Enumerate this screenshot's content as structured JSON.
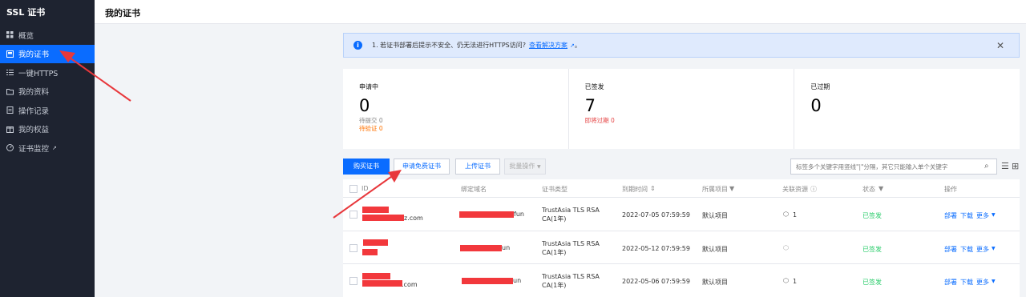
{
  "sidebar": {
    "brand": "SSL 证书",
    "items": [
      {
        "label": "概览",
        "icon": "grid-icon"
      },
      {
        "label": "我的证书",
        "icon": "certificate-icon"
      },
      {
        "label": "一键HTTPS",
        "icon": "list-icon"
      },
      {
        "label": "我的资料",
        "icon": "folder-icon"
      },
      {
        "label": "操作记录",
        "icon": "record-icon"
      },
      {
        "label": "我的权益",
        "icon": "gift-icon"
      },
      {
        "label": "证书监控",
        "icon": "monitor-icon"
      }
    ]
  },
  "header": {
    "title": "我的证书"
  },
  "notice": {
    "text": "1. 若证书部署后提示不安全、仍无法进行HTTPS访问?",
    "link": "查看解决方案",
    "link_suffix": "。"
  },
  "stats": {
    "applying": {
      "label": "申请中",
      "value": "0",
      "sub1": "待提交 0",
      "sub2": "待验证 0"
    },
    "issued": {
      "label": "已签发",
      "value": "7",
      "sub1": "即将过期 0"
    },
    "expired": {
      "label": "已过期",
      "value": "0"
    }
  },
  "toolbar": {
    "buy": "购买证书",
    "apply_free": "申请免费证书",
    "upload": "上传证书",
    "batch": "批量操作",
    "search_placeholder": "标签多个关键字用竖线\"|\"分隔，其它只能输入单个关键字"
  },
  "table": {
    "headers": {
      "id": "ID",
      "domain": "绑定域名",
      "type": "证书类型",
      "expiry": "到期时间",
      "project": "所属项目",
      "resource": "关联资源",
      "status": "状态",
      "ops": "操作"
    },
    "rows": [
      {
        "id_suffix": "z.com",
        "domain_suffix": "fun",
        "type": "TrustAsia TLS RSA CA(1年)",
        "expiry": "2022-07-05 07:59:59",
        "project": "默认项目",
        "resource": "1",
        "status": "已签发"
      },
      {
        "id_suffix": "",
        "domain_suffix": "un",
        "type": "TrustAsia TLS RSA CA(1年)",
        "expiry": "2022-05-12 07:59:59",
        "project": "默认项目",
        "resource": "",
        "status": "已签发"
      },
      {
        "id_suffix": ".com",
        "domain_suffix": "un",
        "type": "TrustAsia TLS RSA CA(1年)",
        "expiry": "2022-05-06 07:59:59",
        "project": "默认项目",
        "resource": "1",
        "status": "已签发"
      }
    ],
    "actions": {
      "deploy": "部署",
      "download": "下载",
      "more": "更多"
    }
  },
  "colors": {
    "accent": "#0a6cff",
    "sidebar_bg": "#1e2330",
    "success": "#29cc6a",
    "annotation": "#e8383c"
  }
}
